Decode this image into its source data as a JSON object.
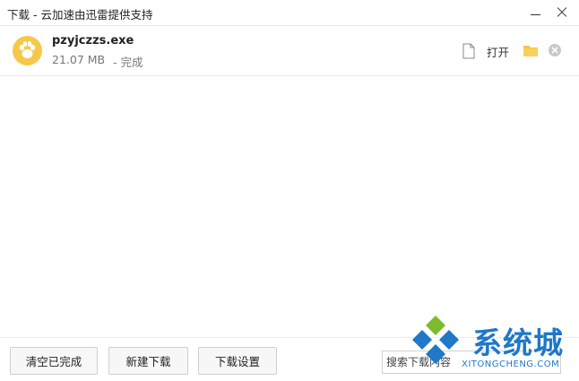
{
  "window": {
    "title": "下载 - 云加速由迅雷提供支持"
  },
  "download": {
    "file_name": "pzyjczzs.exe",
    "file_size": "21.07 MB",
    "status": "- 完成",
    "open_label": "打开"
  },
  "footer": {
    "clear_label": "清空已完成",
    "new_label": "新建下载",
    "settings_label": "下载设置",
    "search_placeholder": "搜索下载内容"
  },
  "watermark": {
    "title": "系统城",
    "subtitle": "XITONGCHENG.COM"
  },
  "colors": {
    "file_icon_bg": "#f6c84a",
    "folder": "#f5c343",
    "watermark_blue": "#1f78c8",
    "watermark_green": "#7dbb2f"
  }
}
